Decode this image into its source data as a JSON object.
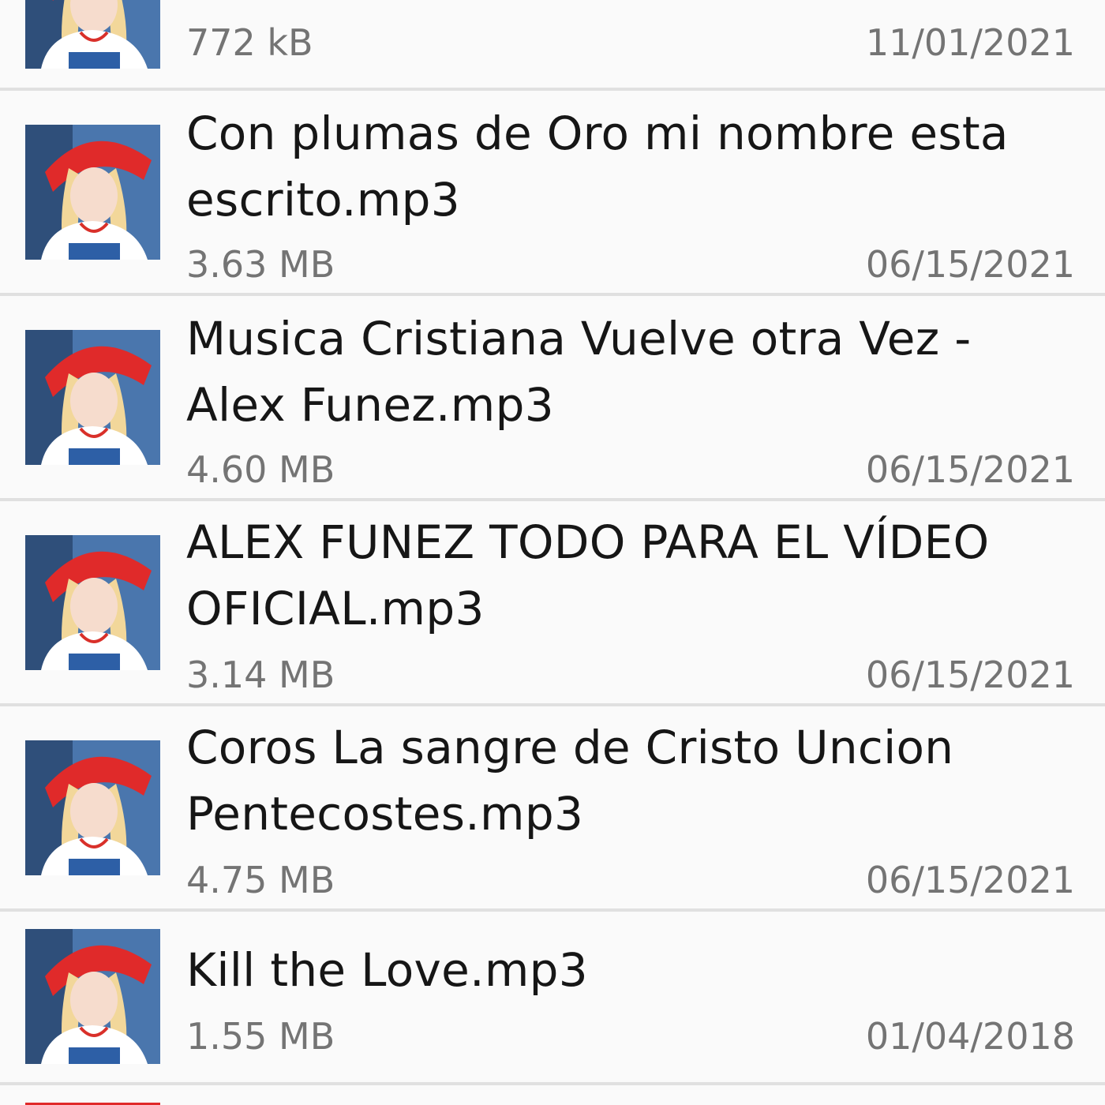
{
  "files": [
    {
      "title_lines": [],
      "size": "772 kB",
      "date": "11/01/2021",
      "thumbnail_icon": "album-art-thumbnail"
    },
    {
      "title_lines": [
        "Con plumas de Oro mi nombre esta",
        "escrito.mp3"
      ],
      "size": "3.63 MB",
      "date": "06/15/2021",
      "thumbnail_icon": "album-art-thumbnail"
    },
    {
      "title_lines": [
        "Musica Cristiana Vuelve otra Vez -",
        "Alex Funez.mp3"
      ],
      "size": "4.60 MB",
      "date": "06/15/2021",
      "thumbnail_icon": "album-art-thumbnail"
    },
    {
      "title_lines": [
        "ALEX FUNEZ TODO PARA EL VÍDEO",
        "OFICIAL.mp3"
      ],
      "size": "3.14 MB",
      "date": "06/15/2021",
      "thumbnail_icon": "album-art-thumbnail"
    },
    {
      "title_lines": [
        "Coros La sangre de Cristo Uncion",
        "Pentecostes.mp3"
      ],
      "size": "4.75 MB",
      "date": "06/15/2021",
      "thumbnail_icon": "album-art-thumbnail"
    },
    {
      "title_lines": [
        "Kill the Love.mp3"
      ],
      "size": "1.55 MB",
      "date": "01/04/2018",
      "thumbnail_icon": "album-art-thumbnail"
    }
  ],
  "colors": {
    "background": "#fafafa",
    "divider": "#e0e0e0",
    "title_text": "#161616",
    "meta_text": "#747474"
  }
}
